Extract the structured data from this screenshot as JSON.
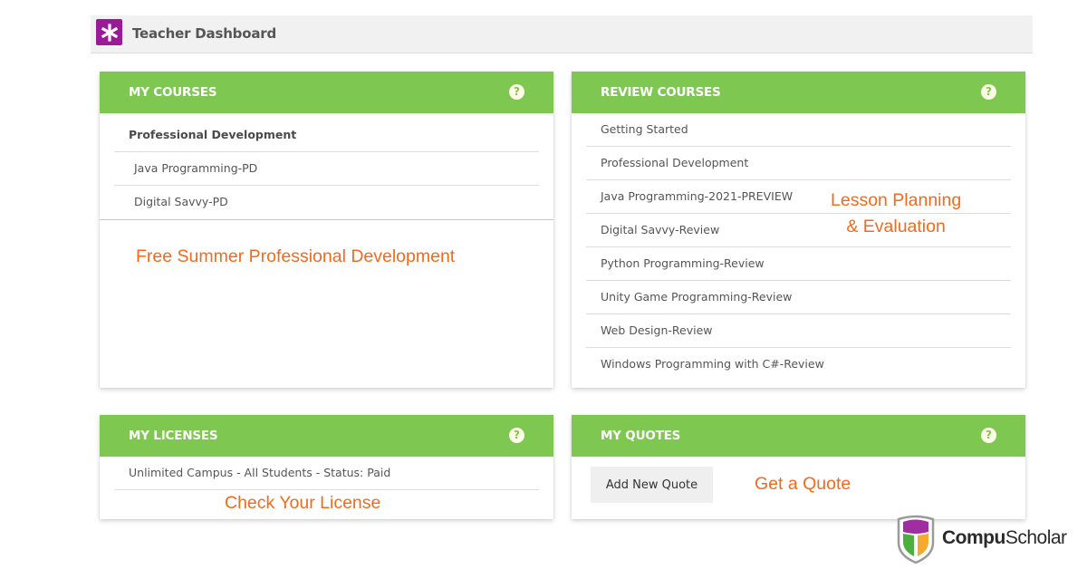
{
  "header": {
    "title": "Teacher Dashboard",
    "logo_icon": "asterisk-icon",
    "logo_color": "#9a1b98"
  },
  "colors": {
    "card_header": "#7ec852",
    "annotation": "#f26a1b"
  },
  "my_courses": {
    "title": "MY COURSES",
    "help_icon": "question-circle-icon",
    "items": [
      {
        "label": "Professional Development",
        "type": "group-header"
      },
      {
        "label": "Java Programming-PD",
        "type": "course"
      },
      {
        "label": "Digital Savvy-PD",
        "type": "course"
      }
    ],
    "annotation": "Free Summer Professional Development"
  },
  "review_courses": {
    "title": "REVIEW COURSES",
    "help_icon": "question-circle-icon",
    "items": [
      {
        "label": "Getting Started"
      },
      {
        "label": "Professional Development"
      },
      {
        "label": "Java Programming-2021-PREVIEW"
      },
      {
        "label": "Digital Savvy-Review"
      },
      {
        "label": "Python Programming-Review"
      },
      {
        "label": "Unity Game Programming-Review"
      },
      {
        "label": "Web Design-Review"
      },
      {
        "label": "Windows Programming with C#-Review"
      }
    ],
    "annotation_line1": "Lesson Planning",
    "annotation_line2": "& Evaluation"
  },
  "my_licenses": {
    "title": "MY LICENSES",
    "help_icon": "question-circle-icon",
    "items": [
      {
        "label": "Unlimited Campus - All Students - Status: Paid"
      }
    ],
    "annotation": "Check Your License"
  },
  "my_quotes": {
    "title": "MY QUOTES",
    "help_icon": "question-circle-icon",
    "add_button": "Add New Quote",
    "annotation": "Get a Quote"
  },
  "brand": {
    "name_bold": "Compu",
    "name_light": "Scholar",
    "icon": "shield-logo-icon"
  }
}
